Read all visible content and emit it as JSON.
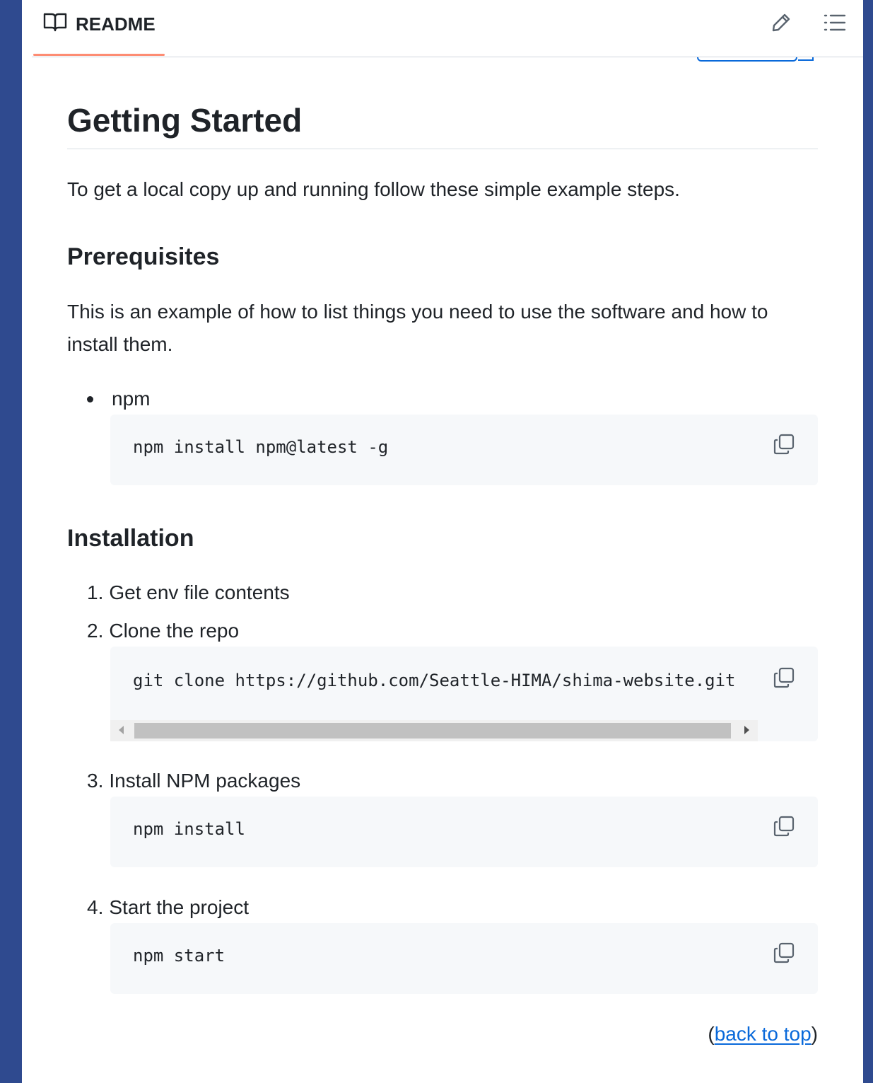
{
  "header": {
    "tab_label": "README",
    "accent_color": "#fd8c73"
  },
  "article": {
    "title": "Getting Started",
    "intro": "To get a local copy up and running follow these simple example steps.",
    "prerequisites": {
      "heading": "Prerequisites",
      "description": "This is an example of how to list things you need to use the software and how to install them.",
      "items": [
        {
          "label": "npm",
          "code": "npm install npm@latest -g"
        }
      ]
    },
    "installation": {
      "heading": "Installation",
      "steps": [
        {
          "number": "1.",
          "label": "Get env file contents"
        },
        {
          "number": "2.",
          "label": "Clone the repo",
          "code": "git clone https://github.com/Seattle-HIMA/shima-website.git"
        },
        {
          "number": "3.",
          "label": "Install NPM packages",
          "code": "npm install"
        },
        {
          "number": "4.",
          "label": "Start the project",
          "code": "npm start"
        }
      ]
    },
    "back_to_top": {
      "open": "(",
      "link_text": "back to top",
      "close": ")"
    }
  },
  "icons": {
    "readme": "book-icon",
    "edit": "pencil-icon",
    "outline": "list-icon",
    "copy": "copy-icon"
  },
  "colors": {
    "link": "#0969da",
    "code_background": "#f6f8fa",
    "frame_background": "#2f4a8f"
  }
}
